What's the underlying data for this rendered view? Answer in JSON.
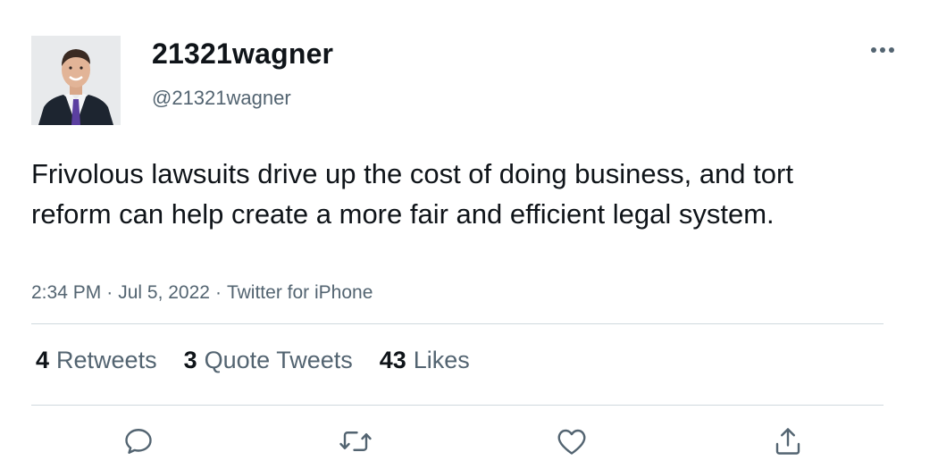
{
  "author": {
    "display_name": "21321wagner",
    "handle": "@21321wagner"
  },
  "tweet": {
    "text": "Frivolous lawsuits drive up the cost of doing business, and tort reform can help create a more fair and efficient legal system.",
    "time": "2:34 PM",
    "date": "Jul 5, 2022",
    "source": "Twitter for iPhone",
    "separator": "·"
  },
  "stats": {
    "retweets": {
      "count": "4",
      "label": "Retweets"
    },
    "quotes": {
      "count": "3",
      "label": "Quote Tweets"
    },
    "likes": {
      "count": "43",
      "label": "Likes"
    }
  },
  "icons": {
    "more": "more-horizontal-icon",
    "reply": "reply-icon",
    "retweet": "retweet-icon",
    "like": "like-icon",
    "share": "share-icon"
  },
  "colors": {
    "text_primary": "#0f1419",
    "text_secondary": "#536471",
    "divider": "#cfd9de"
  }
}
